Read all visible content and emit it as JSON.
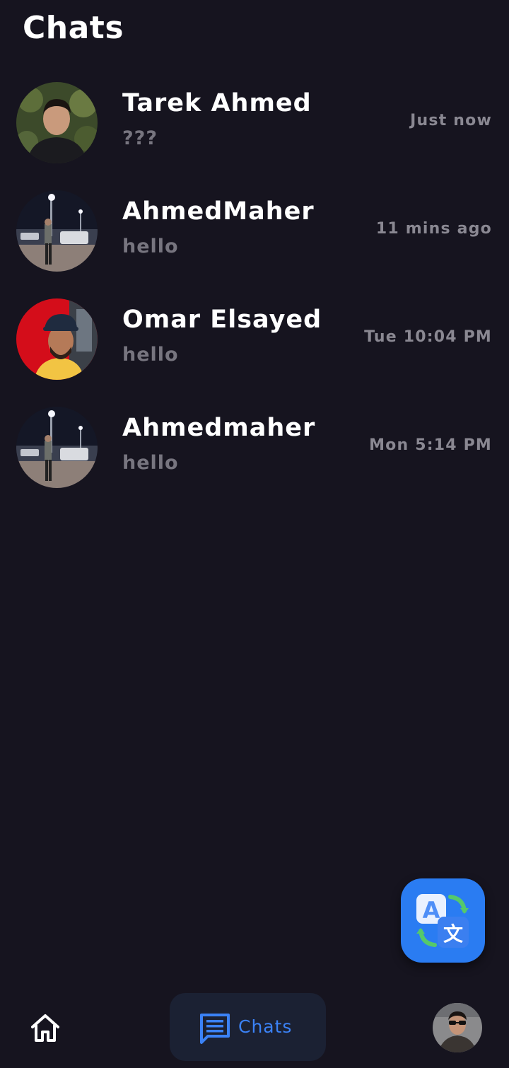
{
  "header": {
    "title": "Chats"
  },
  "chats": [
    {
      "name": "Tarek Ahmed",
      "message": "???",
      "time": "Just now"
    },
    {
      "name": "AhmedMaher",
      "message": "hello",
      "time": "11 mins ago"
    },
    {
      "name": "Omar Elsayed",
      "message": "hello",
      "time": "Tue 10:04 PM"
    },
    {
      "name": "Ahmedmaher",
      "message": "hello",
      "time": "Mon 5:14 PM"
    }
  ],
  "fab": {
    "icon": "translate-icon"
  },
  "bottom_nav": {
    "home_icon": "home-icon",
    "chats_label": "Chats",
    "chats_icon": "chat-message-icon",
    "profile_icon": "avatar"
  },
  "colors": {
    "background": "#16141f",
    "accent": "#2a7cf2",
    "nav_active_bg": "#1b2133",
    "muted_text": "#77757f"
  }
}
